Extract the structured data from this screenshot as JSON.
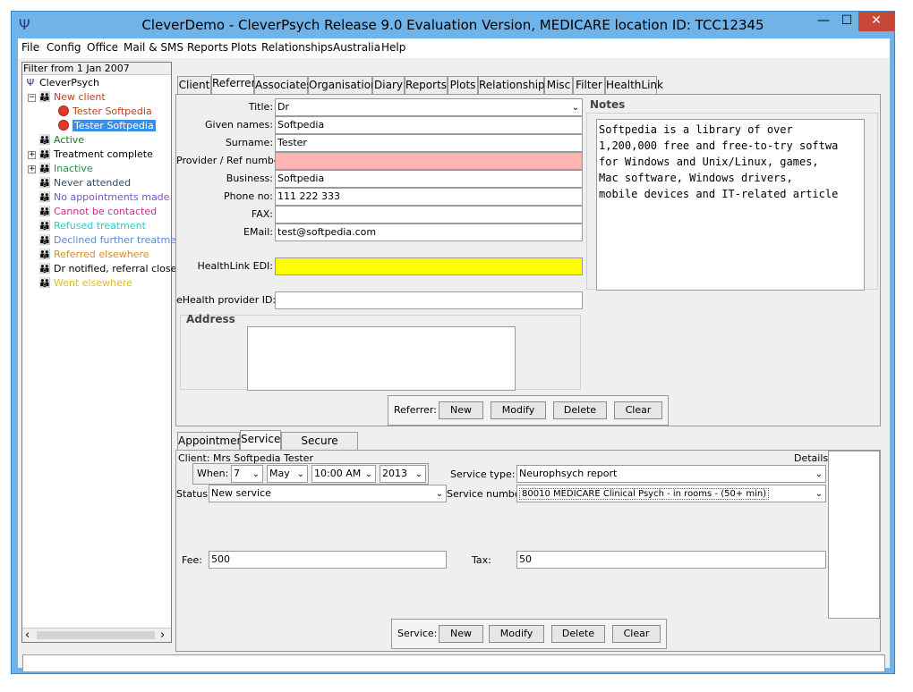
{
  "window": {
    "title": "CleverDemo - CleverPsych Release 9.0 Evaluation Version, MEDICARE location ID: TCC12345",
    "minimize": "—",
    "maximize": "☐",
    "close": "✕"
  },
  "menubar": [
    "File",
    "Config",
    "Office",
    "Mail & SMS",
    "Reports",
    "Plots",
    "Relationships",
    "Australia",
    "Help"
  ],
  "tree": {
    "filter": "Filter from 1 Jan 2007",
    "root": "CleverPsych",
    "nodes": [
      {
        "label": "New client",
        "color": "#b8431c"
      },
      {
        "label": "Tester Softpedia",
        "color": "#b8431c"
      },
      {
        "label": "Tester Softpedia",
        "color": "#ffffff"
      },
      {
        "label": "Active",
        "color": "#1a7a1a"
      },
      {
        "label": "Treatment complete",
        "color": "#000000"
      },
      {
        "label": "Inactive",
        "color": "#2a8a4a"
      },
      {
        "label": "Never attended",
        "color": "#3a4a6a"
      },
      {
        "label": "No appointments made",
        "color": "#7a55c8"
      },
      {
        "label": "Cannot be contacted",
        "color": "#d42a8a"
      },
      {
        "label": "Refused treatment",
        "color": "#2ac8d8"
      },
      {
        "label": "Declined further treatment",
        "color": "#5a8ad8"
      },
      {
        "label": "Referred elsewhere",
        "color": "#e08a2a"
      },
      {
        "label": "Dr notified, referral closed",
        "color": "#000000"
      },
      {
        "label": "Went elsewhere",
        "color": "#e8b82a"
      }
    ]
  },
  "top_tabs": [
    "Client",
    "Referrer",
    "Associates",
    "Organisation",
    "Diary",
    "Reports",
    "Plots",
    "Relationships",
    "Misc",
    "Filter",
    "HealthLink"
  ],
  "referrer": {
    "title_label": "Title:",
    "title_value": "Dr",
    "given_label": "Given names:",
    "given_value": "Softpedia",
    "surname_label": "Surname:",
    "surname_value": "Tester",
    "provider_label": "Provider / Ref number:",
    "provider_value": "",
    "business_label": "Business:",
    "business_value": "Softpedia",
    "phone_label": "Phone no:",
    "phone_value": "111 222 333",
    "fax_label": "FAX:",
    "fax_value": "",
    "email_label": "EMail:",
    "email_value": "test@softpedia.com",
    "healthlink_label": "HealthLink EDI:",
    "healthlink_value": "",
    "ehealth_label": "eHealth provider ID:",
    "ehealth_value": "",
    "address_heading": "Address",
    "notes_heading": "Notes",
    "notes_lines": [
      "Softpedia is a library of over",
      "1,200,000 free and free-to-try softwa",
      "for Windows and Unix/Linux, games,",
      "Mac software, Windows drivers,",
      "mobile devices and IT-related article"
    ],
    "buttons_label": "Referrer:",
    "new": "New",
    "modify": "Modify",
    "delete": "Delete",
    "clear": "Clear"
  },
  "bottom_tabs": [
    "Appointment",
    "Service",
    "Secure Message"
  ],
  "service": {
    "client_label": "Client: Mrs Softpedia Tester",
    "details_label": "Details:",
    "when_label": "When:",
    "day": "7",
    "month": "May",
    "time": "10:00 AM",
    "year": "2013",
    "service_type_label": "Service type:",
    "service_type_value": "Neurophsych report",
    "status_label": "Status:",
    "status_value": "New service",
    "service_number_label": "Service number:",
    "service_number_value": "80010 MEDICARE Clinical Psych - in rooms - (50+ min)",
    "fee_label": "Fee:",
    "fee_value": "500",
    "tax_label": "Tax:",
    "tax_value": "50",
    "buttons_label": "Service:",
    "new": "New",
    "modify": "Modify",
    "delete": "Delete",
    "clear": "Clear"
  },
  "icons": {
    "combo_arrow": "⌄",
    "scroll_left": "‹",
    "scroll_right": "›",
    "expander_minus": "−",
    "expander_plus": "+",
    "person_group": "👪"
  },
  "colors": {
    "selection": "#3b8ee8",
    "provider_field": "#ffb3b3",
    "healthlink_field": "#ffff00",
    "titlebar": "#6fb3e8"
  }
}
